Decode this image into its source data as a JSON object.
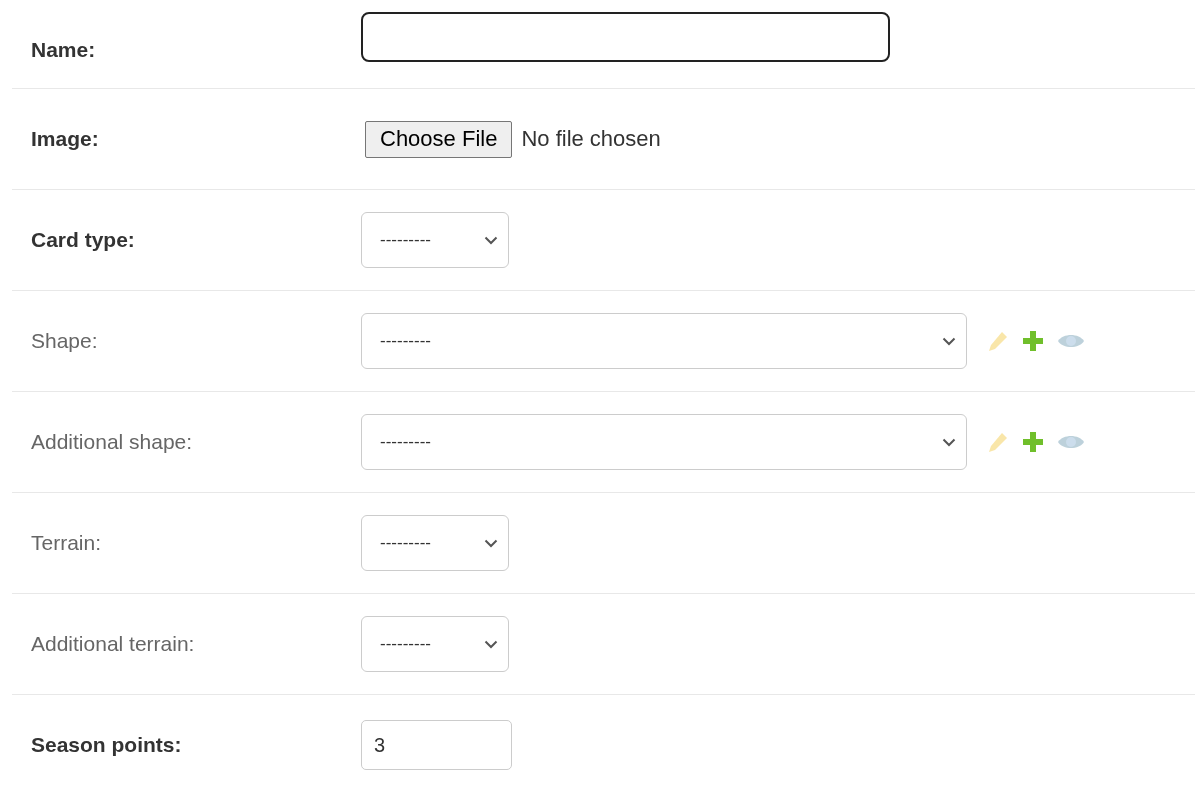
{
  "fields": [
    {
      "label": "Name:",
      "required": true,
      "kind": "text",
      "focused": true
    },
    {
      "label": "Image:",
      "required": true,
      "kind": "file",
      "button": "Choose File",
      "status": "No file chosen"
    },
    {
      "label": "Card type:",
      "required": true,
      "kind": "select",
      "value": "---------"
    },
    {
      "label": "Shape:",
      "required": false,
      "kind": "select",
      "value": "---------",
      "actions": [
        {
          "kind": "edit",
          "disabled": true
        },
        {
          "kind": "add",
          "disabled": false
        },
        {
          "kind": "view",
          "disabled": true
        }
      ]
    },
    {
      "label": "Additional shape:",
      "required": false,
      "kind": "select",
      "value": "---------",
      "actions": [
        {
          "kind": "edit",
          "disabled": true
        },
        {
          "kind": "add",
          "disabled": false
        },
        {
          "kind": "view",
          "disabled": true
        }
      ]
    },
    {
      "label": "Terrain:",
      "required": false,
      "kind": "select",
      "value": "---------"
    },
    {
      "label": "Additional terrain:",
      "required": false,
      "kind": "select",
      "value": "---------"
    },
    {
      "label": "Season points:",
      "required": true,
      "kind": "number",
      "value": "3",
      "focused": false
    }
  ]
}
